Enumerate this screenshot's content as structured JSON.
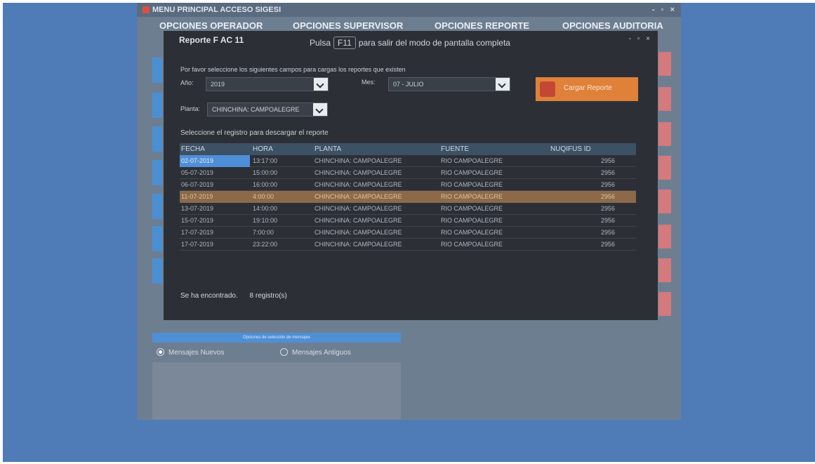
{
  "main_window": {
    "title": "MENU PRINCIPAL ACCESO SIGESI",
    "controls": "- ▫ ×",
    "menu": [
      "OPCIONES OPERADOR",
      "OPCIONES SUPERVISOR",
      "OPCIONES REPORTE",
      "OPCIONES AUDITORIA"
    ],
    "filter_bar_label": "Opciones de selección de mensajes",
    "radios": [
      {
        "label": "Mensajes Nuevos",
        "selected": true
      },
      {
        "label": "Mensajes Antiguos",
        "selected": false
      }
    ]
  },
  "dialog": {
    "title": "Reporte F AC 11",
    "fullscreen_hint": {
      "prefix": "Pulsa",
      "key": "F11",
      "suffix": "para salir del modo de pantalla completa"
    },
    "controls": "- ▫ ×",
    "instruction": "Por favor seleccione los siguientes campos para cargas los reportes que existen",
    "fields": {
      "year_label": "Año:",
      "year_value": "2019",
      "month_label": "Mes:",
      "month_value": "07 - JULIO",
      "plant_label": "Planta:",
      "plant_value": "CHINCHINA: CAMPOALEGRE"
    },
    "load_button": "Cargar Reporte",
    "table_prompt": "Seleccione el registro para descargar el reporte",
    "table": {
      "columns": [
        "FECHA",
        "HORA",
        "PLANTA",
        "FUENTE",
        "NUQIFUS ID"
      ],
      "rows": [
        [
          "02-07-2019",
          "13:17:00",
          "CHINCHINA: CAMPOALEGRE",
          "RIO CAMPOALEGRE",
          "2956"
        ],
        [
          "05-07-2019",
          "15:00:00",
          "CHINCHINA: CAMPOALEGRE",
          "RIO CAMPOALEGRE",
          "2956"
        ],
        [
          "06-07-2019",
          "16:00:00",
          "CHINCHINA: CAMPOALEGRE",
          "RIO CAMPOALEGRE",
          "2956"
        ],
        [
          "11-07-2019",
          "4:00:00",
          "CHINCHINA: CAMPOALEGRE",
          "RIO CAMPOALEGRE",
          "2956"
        ],
        [
          "13-07-2019",
          "14:00:00",
          "CHINCHINA: CAMPOALEGRE",
          "RIO CAMPOALEGRE",
          "2956"
        ],
        [
          "15-07-2019",
          "19:10:00",
          "CHINCHINA: CAMPOALEGRE",
          "RIO CAMPOALEGRE",
          "2956"
        ],
        [
          "17-07-2019",
          "7:00:00",
          "CHINCHINA: CAMPOALEGRE",
          "RIO CAMPOALEGRE",
          "2956"
        ],
        [
          "17-07-2019",
          "23:22:00",
          "CHINCHINA: CAMPOALEGRE",
          "RIO CAMPOALEGRE",
          "2956"
        ]
      ]
    },
    "found": {
      "prefix": "Se ha encontrado.",
      "count": "8",
      "suffix": "registro(s)"
    }
  },
  "colors": {
    "desktop": "#4f7cb7",
    "dialog_bg": "#2c3036",
    "highlight_row": "#8c6a49",
    "selection": "#4f8fd8",
    "load_button": "#e0813a"
  }
}
